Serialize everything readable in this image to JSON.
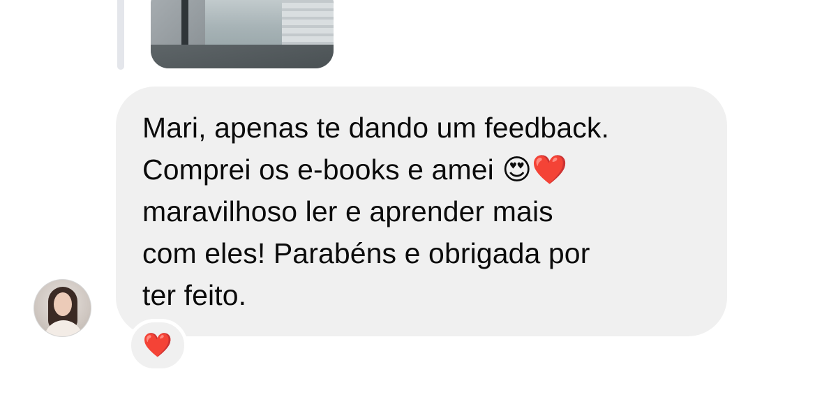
{
  "message": {
    "line1": "Mari, apenas te dando um feedback.",
    "line2_text": "Comprei os e-books e amei ",
    "line2_emoji1": "😍",
    "line2_emoji2": "❤️",
    "line3": "maravilhoso ler e aprender mais",
    "line4": "com eles! Parabéns e obrigada por",
    "line5": "ter feito."
  },
  "reaction": {
    "emoji": "❤️"
  },
  "icons": {
    "reaction": "heart-icon",
    "avatar": "user-avatar"
  },
  "colors": {
    "bubble": "#f0f0f0",
    "text": "#0b0b0b",
    "heart": "#e0202f",
    "reply_line": "#e4e6eb"
  }
}
